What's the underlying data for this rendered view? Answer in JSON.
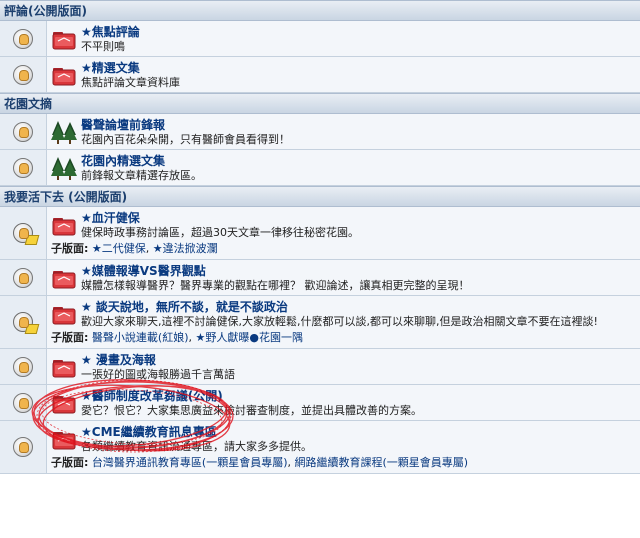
{
  "sections": [
    {
      "title": "評論(公開版面)",
      "forums": [
        {
          "title": "★焦點評論",
          "desc": "不平則鳴",
          "icon": "folder-icon",
          "status_icon": "no-new-posts-icon"
        },
        {
          "title": "★精選文集",
          "desc": "焦點評論文章資料庫",
          "icon": "folder-icon",
          "status_icon": "no-new-posts-icon"
        }
      ]
    },
    {
      "title": "花園文摘",
      "forums": [
        {
          "title": "醫聲論壇前鋒報",
          "desc": "花園內百花朵朵開，只有醫師會員看得到！",
          "icon": "trees-icon",
          "status_icon": "no-new-posts-icon"
        },
        {
          "title": "花園內精選文集",
          "desc": "前鋒報文章精選存放區。",
          "icon": "trees-icon",
          "status_icon": "no-new-posts-icon"
        }
      ]
    },
    {
      "title": "我要活下去 (公開版面)",
      "forums": [
        {
          "title": "★血汗健保",
          "desc": "健保時政事務討論區，超過30天文章一律移往秘密花園。",
          "icon": "folder-icon",
          "status_icon": "new-posts-icon",
          "sub_label": "子版面:",
          "sub_links": [
            "★二代健保",
            "★違法掀波瀾"
          ]
        },
        {
          "title": "★媒體報導VS醫界觀點",
          "desc": "媒體怎樣報導醫界？醫界專業的觀點在哪裡？ 歡迎論述，讓真相更完整的呈現！",
          "icon": "folder-icon",
          "status_icon": "no-new-posts-icon"
        },
        {
          "title": "★ 談天說地，無所不談，就是不談政治",
          "desc": "歡迎大家來聊天,這裡不討論健保,大家放輕鬆,什麼都可以談,都可以來聊聊,但是政治相關文章不要在這裡談!",
          "icon": "folder-icon",
          "status_icon": "new-posts-icon",
          "sub_label": "子版面:",
          "sub_links": [
            "醫聲小說連載(紅娘)",
            "★野人獻曝●花園一隅"
          ]
        },
        {
          "title": "★ 漫畫及海報",
          "desc": "一張好的圖或海報勝過千言萬語",
          "icon": "folder-icon",
          "status_icon": "no-new-posts-icon"
        },
        {
          "title": "★醫師制度改革芻議(公開)",
          "desc": "愛它？恨它？大家集思廣益來檢討審查制度，並提出具體改善的方案。",
          "icon": "folder-icon",
          "status_icon": "no-new-posts-icon"
        },
        {
          "title": "★CME繼續教育訊息專區",
          "desc": "各類繼續教育資訊流通專區，請大家多多提供。",
          "icon": "folder-icon",
          "status_icon": "no-new-posts-icon",
          "sub_label": "子版面:",
          "sub_links": [
            "台灣醫界通訊教育專區(一顆星會員專屬)",
            "網路繼續教育課程(一顆星會員專屬)"
          ]
        }
      ]
    }
  ],
  "colors": {
    "category_text": "#1c3f6e",
    "link": "#0a3a80",
    "annotation": "#e0101a",
    "folder": "#d9363a"
  }
}
